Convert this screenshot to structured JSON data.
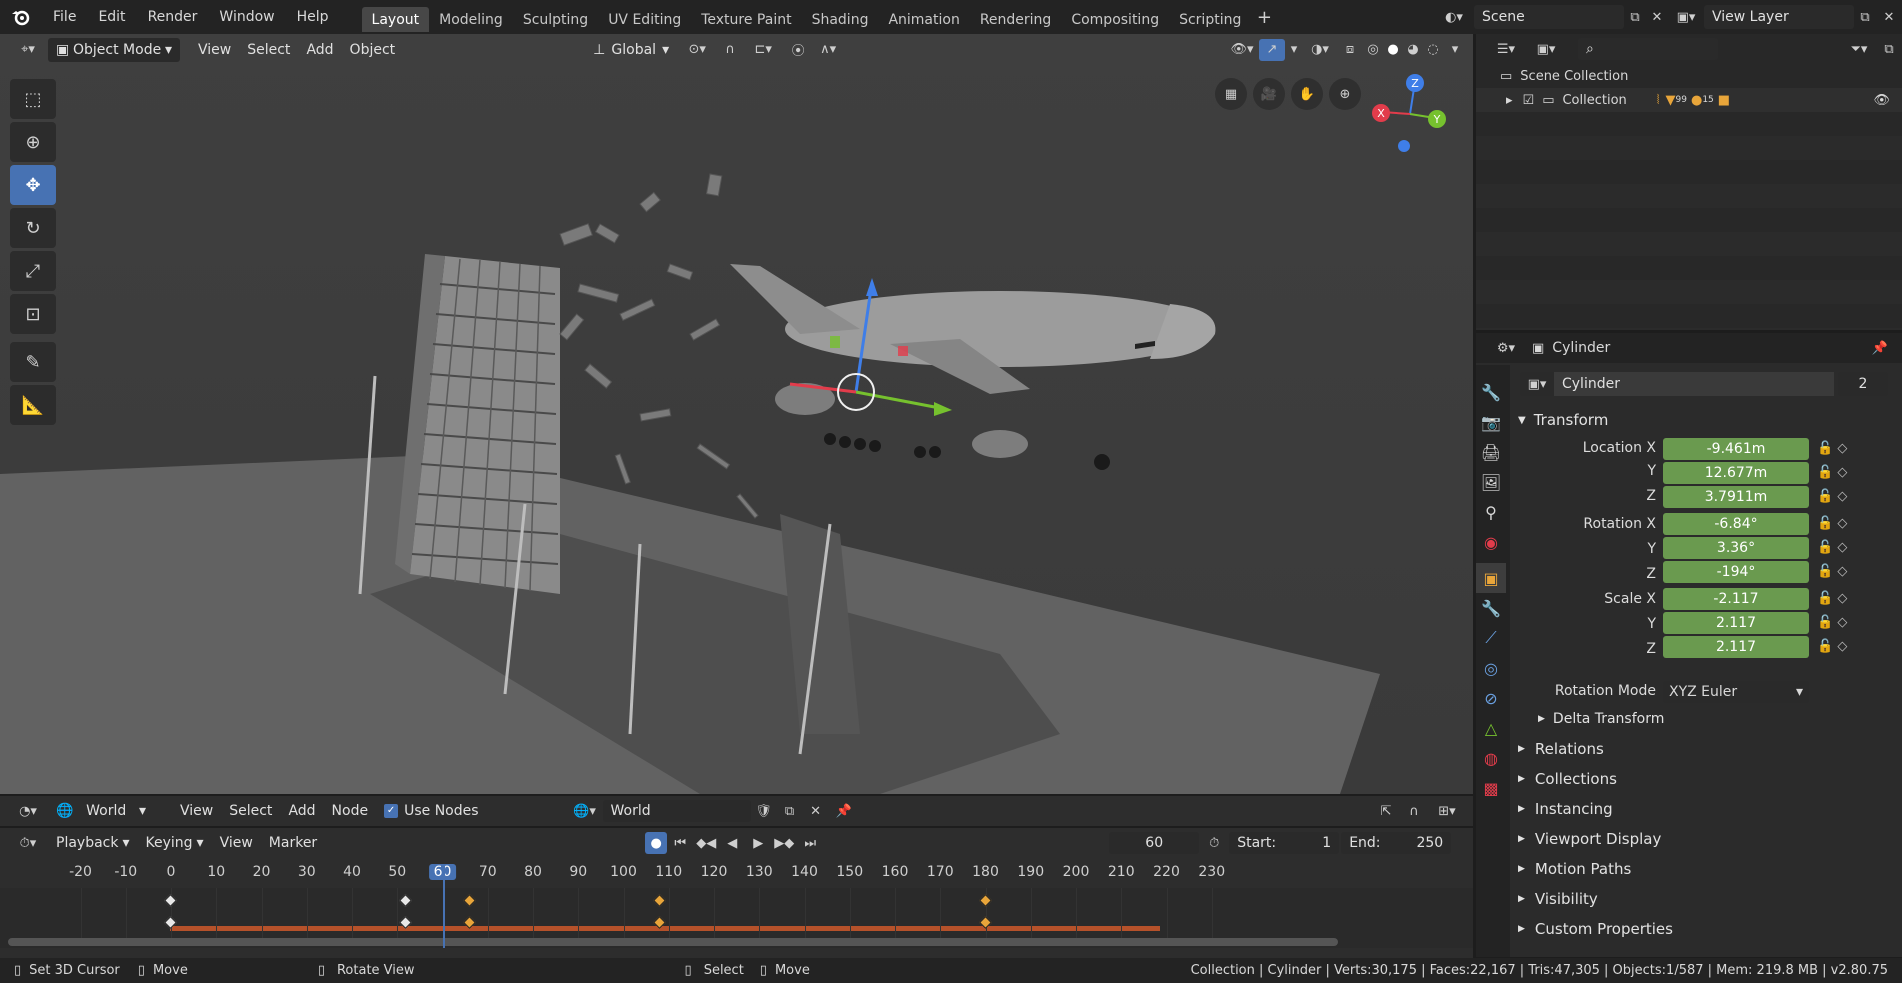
{
  "topbar": {
    "menus": [
      "File",
      "Edit",
      "Render",
      "Window",
      "Help"
    ],
    "workspaces": [
      "Layout",
      "Modeling",
      "Sculpting",
      "UV Editing",
      "Texture Paint",
      "Shading",
      "Animation",
      "Rendering",
      "Compositing",
      "Scripting"
    ],
    "scene": "Scene",
    "view_layer": "View Layer"
  },
  "viewport_header": {
    "mode": "Object Mode",
    "menus": [
      "View",
      "Select",
      "Add",
      "Object"
    ],
    "orientation": "Global"
  },
  "outliner": {
    "scene_collection": "Scene Collection",
    "collection": "Collection",
    "badge_1": "99",
    "badge_2": "15"
  },
  "properties": {
    "object_name": "Cylinder",
    "data_name": "Cylinder",
    "users": "2",
    "transform_label": "Transform",
    "location_label": "Location X",
    "rotation_label": "Rotation X",
    "scale_label": "Scale X",
    "y_label": "Y",
    "z_label": "Z",
    "location": [
      "-9.461m",
      "12.677m",
      "3.7911m"
    ],
    "rotation": [
      "-6.84°",
      "3.36°",
      "-194°"
    ],
    "scale": [
      "-2.117",
      "2.117",
      "2.117"
    ],
    "rotation_mode_label": "Rotation Mode",
    "rotation_mode": "XYZ Euler",
    "delta_transform": "Delta Transform",
    "sections": [
      "Relations",
      "Collections",
      "Instancing",
      "Viewport Display",
      "Motion Paths",
      "Visibility",
      "Custom Properties"
    ]
  },
  "node_header": {
    "editor": "World",
    "menus": [
      "View",
      "Select",
      "Add",
      "Node"
    ],
    "use_nodes": "Use Nodes",
    "world": "World"
  },
  "timeline": {
    "menus": [
      "Playback",
      "Keying",
      "View",
      "Marker"
    ],
    "current_frame": "60",
    "start_label": "Start:",
    "start": "1",
    "end_label": "End:",
    "end": "250",
    "ticks": [
      "-20",
      "-10",
      "0",
      "10",
      "20",
      "30",
      "40",
      "50",
      "60",
      "70",
      "80",
      "90",
      "100",
      "110",
      "120",
      "130",
      "140",
      "150",
      "160",
      "170",
      "180",
      "190",
      "200",
      "210",
      "220",
      "230"
    ],
    "keyframes": [
      0,
      52,
      66,
      108,
      180
    ]
  },
  "statusbar": {
    "set_cursor": "Set 3D Cursor",
    "move": "Move",
    "rotate": "Rotate View",
    "select": "Select",
    "move2": "Move",
    "stats": "Collection | Cylinder | Verts:30,175 | Faces:22,167 | Tris:47,305 | Objects:1/587 | Mem: 219.8 MB | v2.80.75"
  },
  "gizmo": {
    "x": "X",
    "y": "Y",
    "z": "Z"
  },
  "colors": {
    "accent": "#4772b3",
    "green_field": "#6a9a4f",
    "orange": "#e8a53a"
  }
}
